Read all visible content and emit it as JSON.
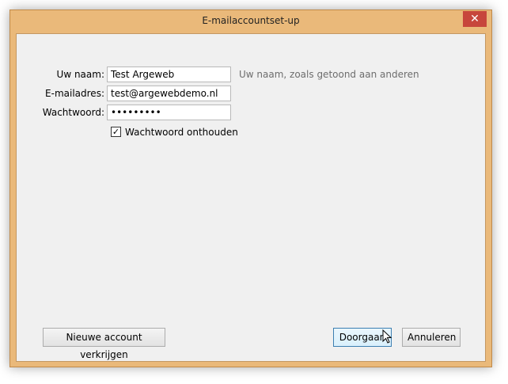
{
  "window": {
    "title": "E-mailaccountset-up",
    "close_glyph": "✕"
  },
  "form": {
    "name_label": "Uw naam:",
    "name_value": "Test Argeweb",
    "name_hint": "Uw naam, zoals getoond aan anderen",
    "email_label": "E-mailadres:",
    "email_value": "test@argewebdemo.nl",
    "password_label": "Wachtwoord:",
    "password_value": "•••••••••",
    "remember_label": "Wachtwoord onthouden",
    "remember_checked": true
  },
  "buttons": {
    "new_account": "Nieuwe account verkrijgen",
    "continue": "Doorgaan",
    "cancel": "Annuleren"
  },
  "colors": {
    "accent": "#3c7fb1",
    "frame": "#eab97a",
    "close": "#c7463c"
  }
}
